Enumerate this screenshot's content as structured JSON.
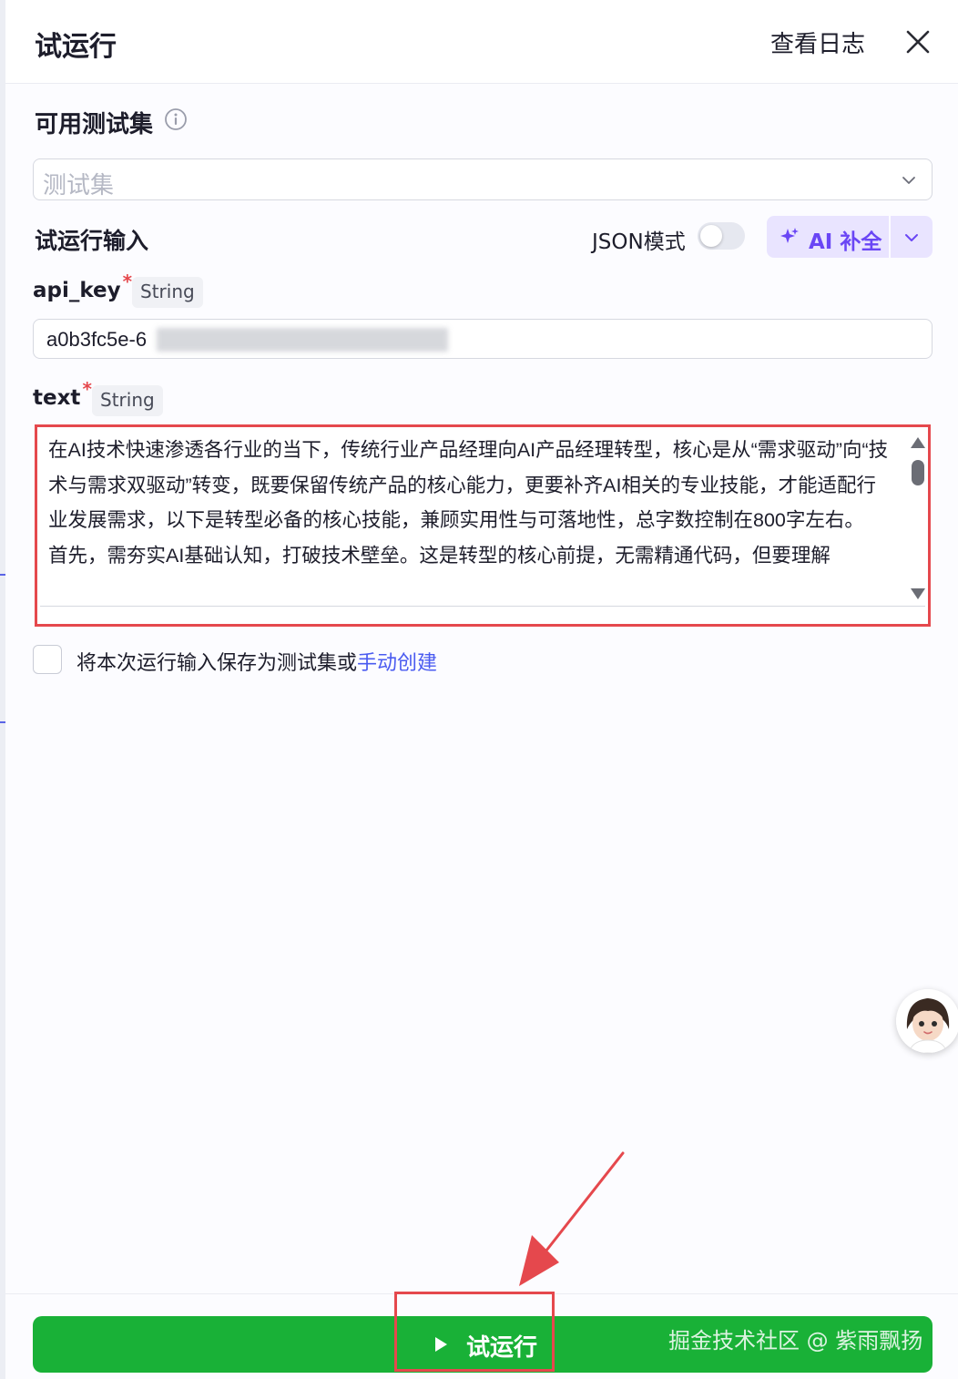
{
  "header": {
    "title": "试运行",
    "view_log": "查看日志"
  },
  "testset": {
    "label": "可用测试集",
    "placeholder": "测试集"
  },
  "inputs": {
    "label": "试运行输入",
    "json_mode_label": "JSON模式",
    "json_mode_on": false,
    "ai_label": "AI 补全"
  },
  "fields": [
    {
      "name": "api_key",
      "required_mark": "*",
      "type": "String",
      "value": "a0b3fc5e-6"
    },
    {
      "name": "text",
      "required_mark": "*",
      "type": "String",
      "lines": [
        "在AI技术快速渗透各行业的当下，传统行业产品经理向AI产品经理转型，核心是从“需求驱动”向“技术与需求双驱动”转变，既要保留传统产品的核心能力，更要补齐AI相关的专业技能，才能适配行业发展需求，以下是转型必备的核心技能，兼顾实用性与可落地性，总字数控制在800字左右。",
        "首先，需夯实AI基础认知，打破技术壁垒。这是转型的核心前提，无需精通代码，但要理解"
      ]
    }
  ],
  "save": {
    "text": "将本次运行输入保存为测试集或",
    "link": "手动创建",
    "checked": false
  },
  "run_button": {
    "label": "试运行"
  },
  "watermark": "掘金技术社区 @ 紫雨飘扬",
  "colors": {
    "primary_green": "#19b137",
    "ai_purple": "#6a46f5",
    "annotation_red": "#e5484d",
    "link_blue": "#4a5bf0"
  },
  "icons": {
    "close": "close-icon",
    "info": "info-icon",
    "chevron": "chevron-down-icon",
    "sparkle": "sparkle-icon",
    "play": "play-icon",
    "avatar": "assistant-avatar"
  }
}
